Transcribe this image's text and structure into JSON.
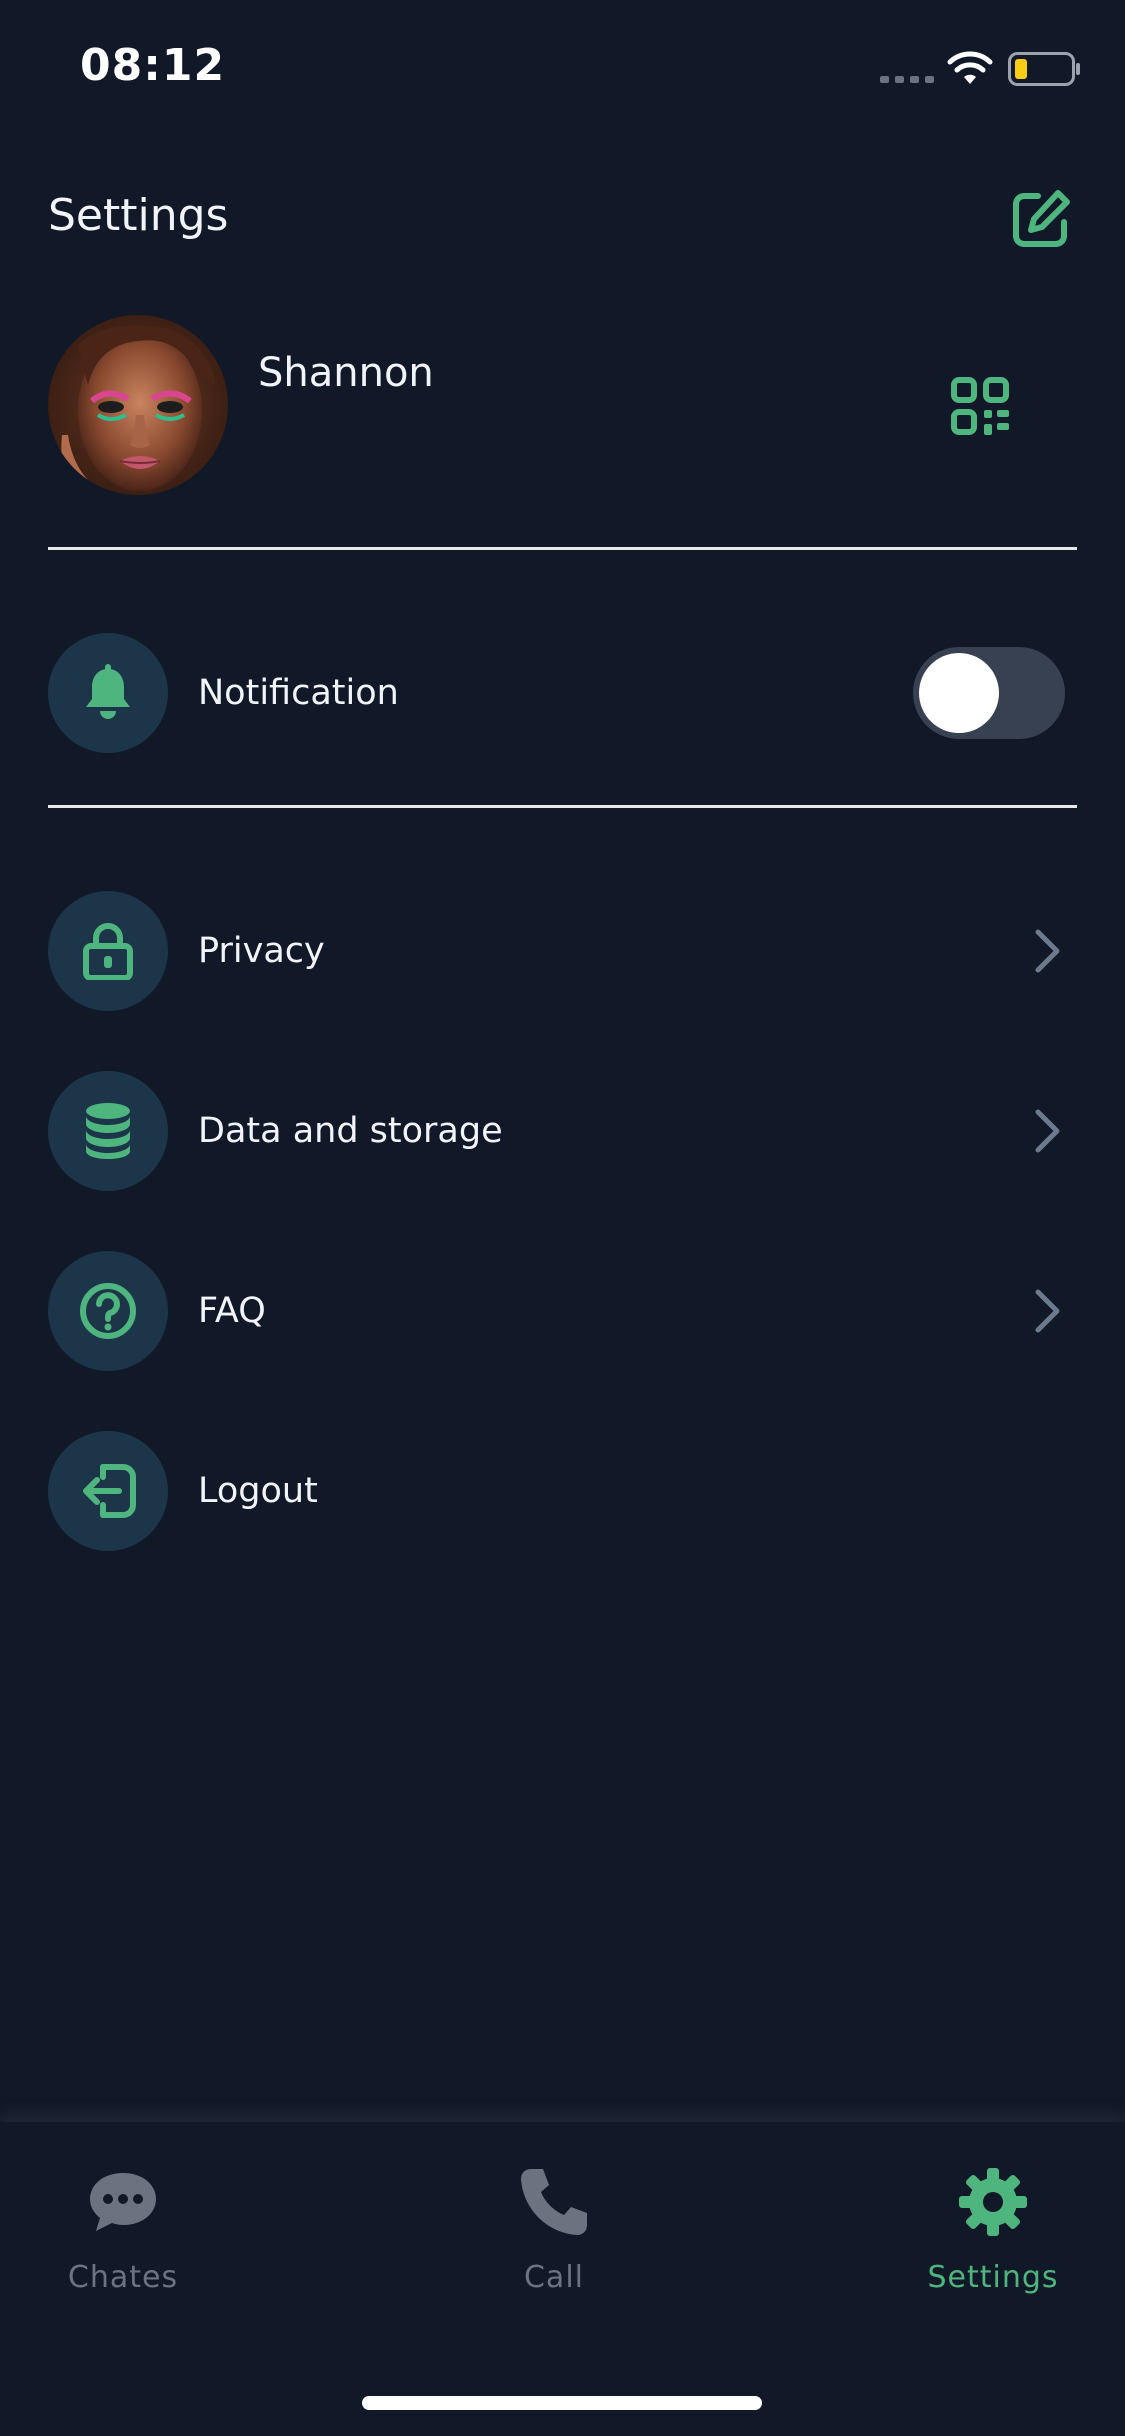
{
  "status_bar": {
    "time": "08:12"
  },
  "header": {
    "title": "Settings",
    "edit_icon": "edit-square-icon"
  },
  "profile": {
    "name": "Shannon",
    "avatar": "avatar-photo",
    "qr_icon": "qr-code-icon"
  },
  "notification": {
    "label": "Notification",
    "icon": "bell-icon",
    "enabled": false
  },
  "menu": [
    {
      "label": "Privacy",
      "icon": "lock-icon"
    },
    {
      "label": "Data and storage",
      "icon": "database-icon"
    },
    {
      "label": "FAQ",
      "icon": "help-circle-icon"
    },
    {
      "label": "Logout",
      "icon": "logout-icon"
    }
  ],
  "bottom_nav": {
    "items": [
      {
        "label": "Chates",
        "icon": "chat-bubble-icon",
        "active": false
      },
      {
        "label": "Call",
        "icon": "phone-icon",
        "active": false
      },
      {
        "label": "Settings",
        "icon": "gear-icon",
        "active": true
      }
    ]
  },
  "colors": {
    "background": "#111827",
    "accent": "#4fb57e",
    "icon_circle": "#1c3548",
    "inactive": "#6b7280"
  }
}
